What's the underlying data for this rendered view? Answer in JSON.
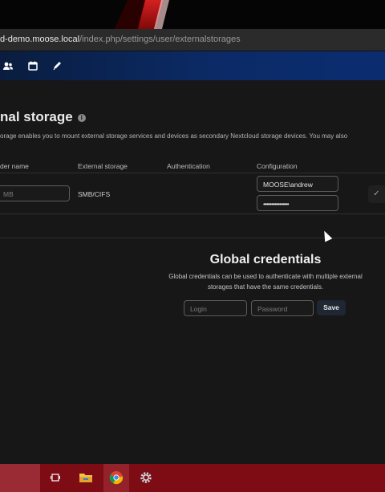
{
  "browser": {
    "url_host": "d-demo.moose.local",
    "url_path": "/index.php/settings/user/externalstorages"
  },
  "header": {
    "icons": [
      "contacts-icon",
      "calendar-icon",
      "notes-icon"
    ]
  },
  "page": {
    "title": "nal storage",
    "description": "orage enables you to mount external storage services and devices as secondary Nextcloud storage devices. You may also"
  },
  "table": {
    "columns": [
      "der name",
      "External storage",
      "Authentication",
      "Configuration"
    ],
    "row": {
      "folder_placeholder": "MB",
      "storage": "SMB/CIFS",
      "username": "MOOSE\\andrew",
      "password_mask": "••••••••••••••••"
    }
  },
  "global_credentials": {
    "title": "Global credentials",
    "description": "Global credentials can be used to authenticate with multiple external storages that have the same credentials.",
    "login_placeholder": "Login",
    "password_placeholder": "Password",
    "save_label": "Save"
  },
  "taskbar": {
    "icons": [
      "task-view-icon",
      "file-explorer-icon",
      "chrome-icon",
      "settings-icon"
    ]
  },
  "colors": {
    "header": "#0b2a66",
    "taskbar": "#7d0c14"
  }
}
